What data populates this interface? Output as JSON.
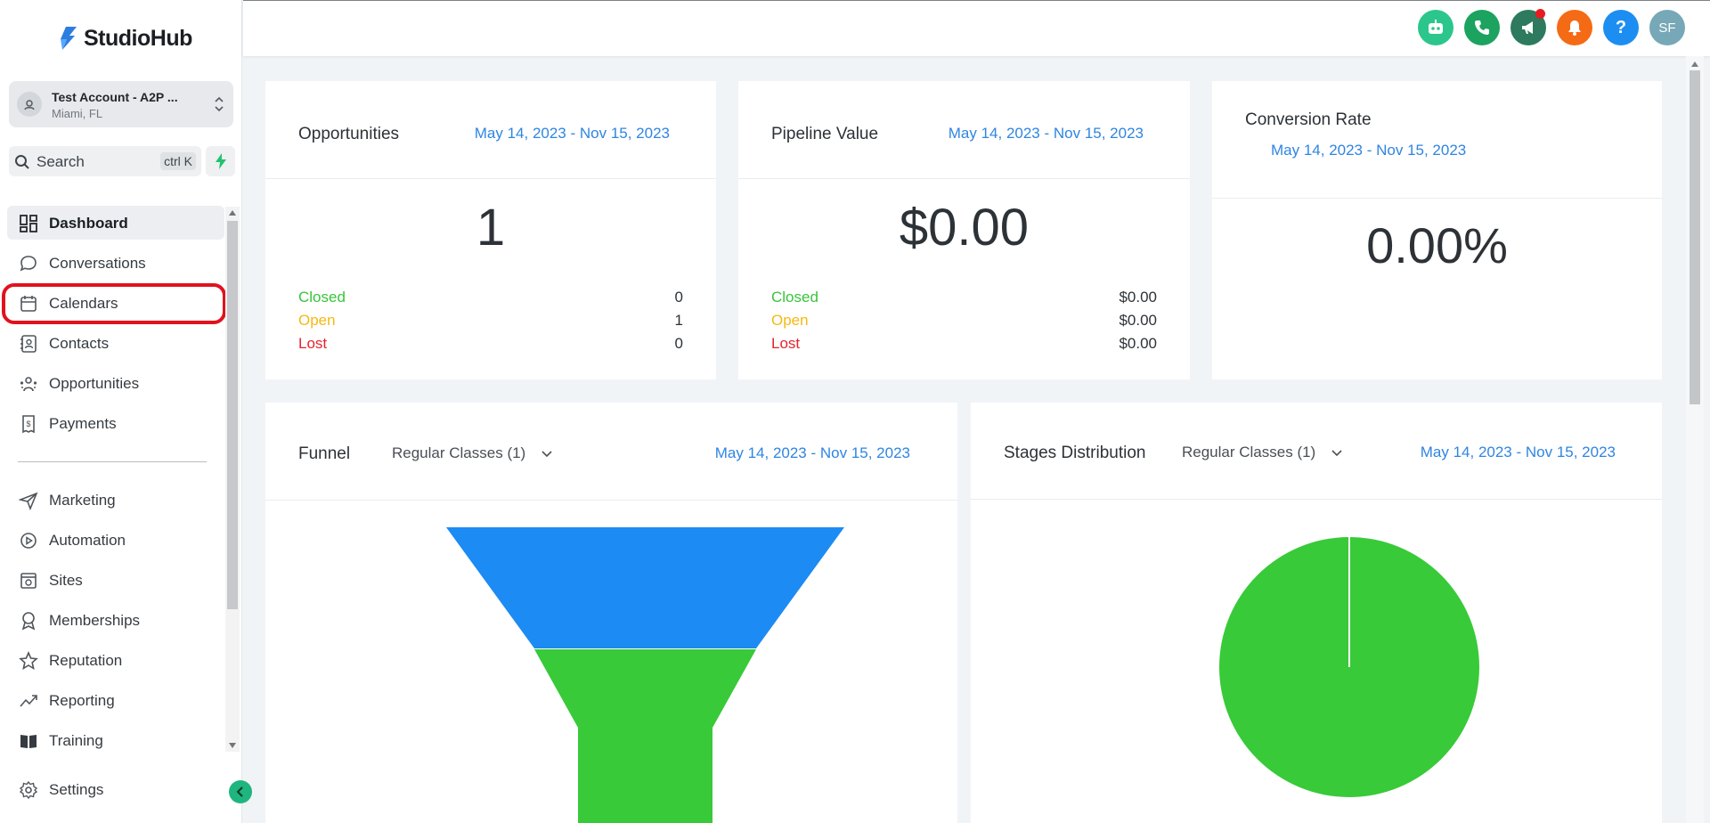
{
  "app": {
    "logo_text": "StudioHub"
  },
  "account": {
    "name": "Test Account - A2P ...",
    "location": "Miami, FL"
  },
  "search": {
    "label": "Search",
    "shortcut": "ctrl K"
  },
  "sidebar": {
    "items": [
      {
        "label": "Dashboard",
        "icon": "dashboard-icon",
        "active": true
      },
      {
        "label": "Conversations",
        "icon": "chat-bubble-icon"
      },
      {
        "label": "Calendars",
        "icon": "calendar-icon",
        "highlighted": true
      },
      {
        "label": "Contacts",
        "icon": "contacts-icon"
      },
      {
        "label": "Opportunities",
        "icon": "opportunities-icon"
      },
      {
        "label": "Payments",
        "icon": "payments-icon"
      },
      {
        "label": "Marketing",
        "icon": "send-icon"
      },
      {
        "label": "Automation",
        "icon": "automation-icon"
      },
      {
        "label": "Sites",
        "icon": "sites-icon"
      },
      {
        "label": "Memberships",
        "icon": "badge-icon"
      },
      {
        "label": "Reputation",
        "icon": "star-icon"
      },
      {
        "label": "Reporting",
        "icon": "trend-icon"
      },
      {
        "label": "Training",
        "icon": "book-icon"
      }
    ],
    "settings_label": "Settings"
  },
  "header": {
    "buttons": [
      {
        "name": "ai-assistant",
        "icon": "robot-icon",
        "color": "#2bc68b"
      },
      {
        "name": "phone",
        "icon": "phone-icon",
        "color": "#1ba35f"
      },
      {
        "name": "announcements",
        "icon": "megaphone-icon",
        "color": "#2d7a5e",
        "has_dot": true
      },
      {
        "name": "notifications",
        "icon": "bell-icon",
        "color": "#f56a15"
      },
      {
        "name": "help",
        "icon": "question-icon",
        "color": "#1c8ef1"
      },
      {
        "name": "user-avatar",
        "initials": "SF",
        "color": "#76a8b8"
      }
    ]
  },
  "cards": {
    "opportunities": {
      "title": "Opportunities",
      "date_range": "May 14, 2023 - Nov 15, 2023",
      "value": "1",
      "rows": [
        {
          "label": "Closed",
          "value": "0",
          "color": "#37c53a"
        },
        {
          "label": "Open",
          "value": "1",
          "color": "#f6b812"
        },
        {
          "label": "Lost",
          "value": "0",
          "color": "#e8222c"
        }
      ]
    },
    "pipeline": {
      "title": "Pipeline Value",
      "date_range": "May 14, 2023 - Nov 15, 2023",
      "value": "$0.00",
      "rows": [
        {
          "label": "Closed",
          "value": "$0.00",
          "color": "#37c53a"
        },
        {
          "label": "Open",
          "value": "$0.00",
          "color": "#f6b812"
        },
        {
          "label": "Lost",
          "value": "$0.00",
          "color": "#e8222c"
        }
      ]
    },
    "conversion": {
      "title": "Conversion Rate",
      "date_range": "May 14, 2023 - Nov 15, 2023",
      "value": "0.00%"
    },
    "funnel": {
      "title": "Funnel",
      "pipeline_select": "Regular Classes (1)",
      "date_range": "May 14, 2023 - Nov 15, 2023"
    },
    "stages": {
      "title": "Stages Distribution",
      "pipeline_select": "Regular Classes (1)",
      "date_range": "May 14, 2023 - Nov 15, 2023"
    }
  },
  "chart_data": [
    {
      "type": "funnel",
      "stages": [
        {
          "color": "#1c8bf3"
        },
        {
          "color": "#38ca38"
        }
      ]
    },
    {
      "type": "pie",
      "slices": [
        {
          "value": 100,
          "color": "#38ca38"
        }
      ]
    }
  ]
}
